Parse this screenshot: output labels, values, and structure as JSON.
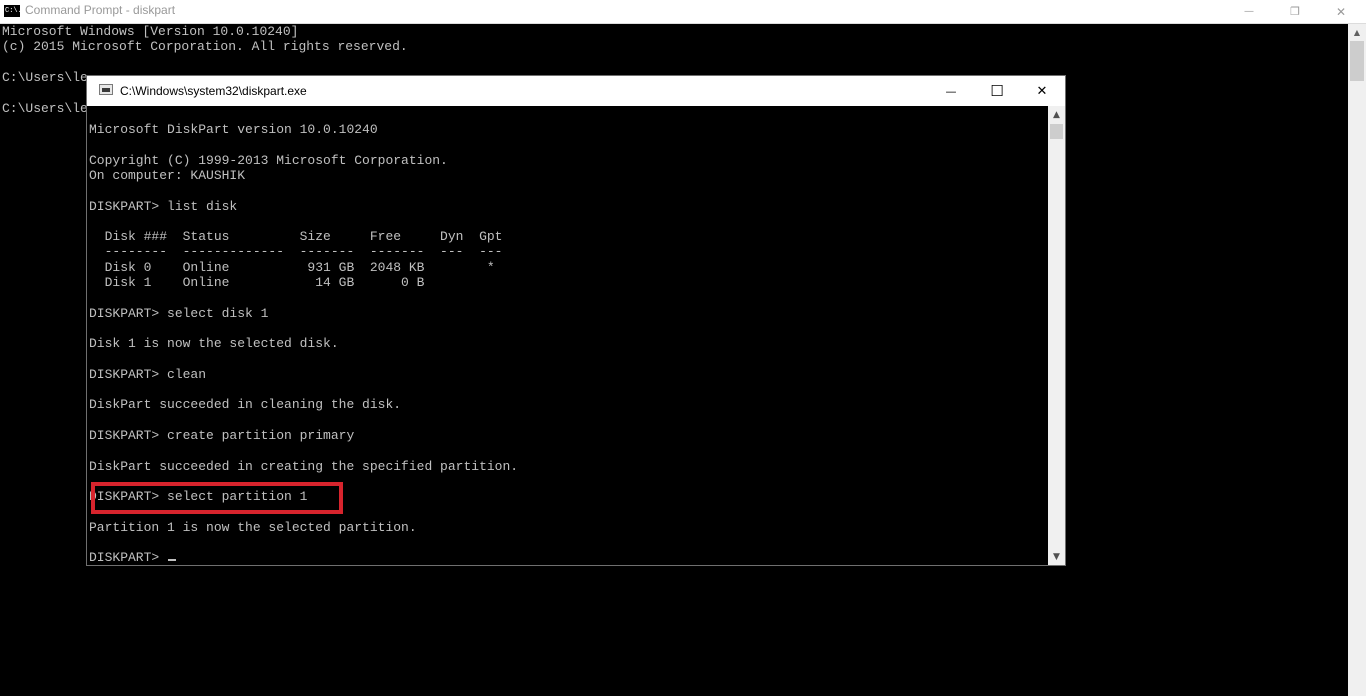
{
  "outer_window": {
    "icon_text": "C:\\.",
    "title": "Command Prompt - diskpart",
    "controls": {
      "minimize": "—",
      "restore": "❐",
      "close": "✕"
    },
    "lines": [
      "Microsoft Windows [Version 10.0.10240]",
      "(c) 2015 Microsoft Corporation. All rights reserved.",
      "",
      "C:\\Users\\le",
      "",
      "C:\\Users\\le"
    ]
  },
  "diskpart_window": {
    "title": "C:\\Windows\\system32\\diskpart.exe",
    "controls": {
      "minimize": "—",
      "maximize": "☐",
      "close": "✕"
    },
    "lines": [
      "Microsoft DiskPart version 10.0.10240",
      "",
      "Copyright (C) 1999-2013 Microsoft Corporation.",
      "On computer: KAUSHIK",
      "",
      "DISKPART> list disk",
      "",
      "  Disk ###  Status         Size     Free     Dyn  Gpt",
      "  --------  -------------  -------  -------  ---  ---",
      "  Disk 0    Online          931 GB  2048 KB        *",
      "  Disk 1    Online           14 GB      0 B",
      "",
      "DISKPART> select disk 1",
      "",
      "Disk 1 is now the selected disk.",
      "",
      "DISKPART> clean",
      "",
      "DiskPart succeeded in cleaning the disk.",
      "",
      "DISKPART> create partition primary",
      "",
      "DiskPart succeeded in creating the specified partition.",
      "",
      "DISKPART> select partition 1",
      "",
      "Partition 1 is now the selected partition.",
      "",
      "DISKPART> "
    ],
    "highlighted_line_index": 24
  },
  "scrollbar": {
    "up_arrow": "▲",
    "down_arrow": "▼"
  },
  "colors": {
    "console_text": "#c0c0c0",
    "console_bg": "#000000",
    "highlight_border": "#d7242d"
  }
}
